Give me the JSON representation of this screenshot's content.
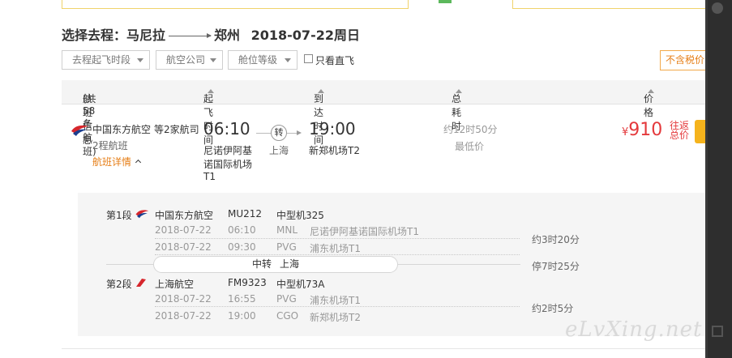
{
  "route": {
    "prefix": "选择去程：",
    "from": "马尼拉",
    "to": "郑州",
    "date": "2018-07-22周日"
  },
  "filters": [
    {
      "label": "去程起飞时段"
    },
    {
      "label": "航空公司"
    },
    {
      "label": "舱位等级"
    }
  ],
  "direct_only_label": "只看直飞",
  "exclude_tax_label": "不含税价",
  "table_header": {
    "flight_info": "航班信息",
    "flight_count": "(共58条航班)",
    "depart": "起飞时间",
    "arrive": "到达时间",
    "duration": "总耗时",
    "price": "价格"
  },
  "flight": {
    "airline": "中国东方航空",
    "airline_extra": "等2家航司",
    "legs_note": "2程航班",
    "detail_link": "航班详情",
    "depart_time": "06:10",
    "depart_airport_l1": "尼诺伊阿基",
    "depart_airport_l2": "诺国际机场",
    "depart_airport_l3": "T1",
    "transfer_badge": "转",
    "transfer_city": "上海",
    "arrive_time": "19:00",
    "arrive_airport": "新郑机场T2",
    "total_duration": "约12时50分",
    "lowest_tag": "最低价",
    "currency": "¥",
    "price": "910",
    "round_trip_l1": "往返",
    "round_trip_l2": "总价"
  },
  "segments": [
    {
      "label": "第1段",
      "airline": "中国东方航空",
      "flight_no": "MU212",
      "aircraft": "中型机325",
      "dep_date": "2018-07-22",
      "dep_time": "06:10",
      "dep_code": "MNL",
      "dep_airport": "尼诺伊阿基诺国际机场T1",
      "arr_date": "2018-07-22",
      "arr_time": "09:30",
      "arr_code": "PVG",
      "arr_airport": "浦东机场T1",
      "duration": "约3时20分"
    },
    {
      "label": "第2段",
      "airline": "上海航空",
      "flight_no": "FM9323",
      "aircraft": "中型机73A",
      "dep_date": "2018-07-22",
      "dep_time": "16:55",
      "dep_code": "PVG",
      "dep_airport": "浦东机场T1",
      "arr_date": "2018-07-22",
      "arr_time": "19:00",
      "arr_code": "CGO",
      "arr_airport": "新郑机场T2",
      "duration": "约2时5分"
    }
  ],
  "layover": {
    "label": "中转",
    "city": "上海",
    "duration": "停7时25分"
  },
  "watermark": "eLvXing.net",
  "colors": {
    "price_red": "#e4393c",
    "link_orange": "#e67e16",
    "book_yellow": "#f5b31c",
    "ce_red": "#d6262c",
    "ce_blue": "#1b3f8f"
  }
}
